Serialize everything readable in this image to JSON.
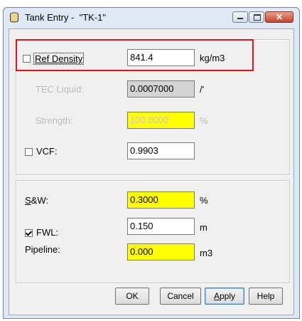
{
  "window": {
    "title": "Tank Entry -  \"TK-1\""
  },
  "density": {
    "label": "Ref Density",
    "checked": false,
    "value": "841.4",
    "unit": "kg/m3"
  },
  "tec": {
    "label": "TEC Liquid:",
    "value": "0.0007000",
    "unit": "/'"
  },
  "strength": {
    "label": "Strength:",
    "value": "100.0000",
    "unit": "%"
  },
  "vcf": {
    "label": "VCF:",
    "checked": false,
    "value": "0.9903"
  },
  "sw": {
    "label_hot": "S",
    "label_rest": "&W:",
    "value": "0.3000",
    "unit": "%"
  },
  "fwl": {
    "label": "FWL:",
    "checked": true,
    "value": "0.150",
    "unit": "m"
  },
  "pipeline": {
    "label": "Pipeline:",
    "value": "0.000",
    "unit": "m3"
  },
  "buttons": {
    "ok": "OK",
    "cancel": "Cancel",
    "apply_hot": "A",
    "apply_rest": "pply",
    "help": "Help"
  },
  "colors": {
    "required_field": "#ffff00",
    "highlight_box": "#e0161a"
  },
  "icons": {
    "app": "tank-icon",
    "minimize": "minimize-icon",
    "maximize": "maximize-icon",
    "close": "close-icon"
  }
}
